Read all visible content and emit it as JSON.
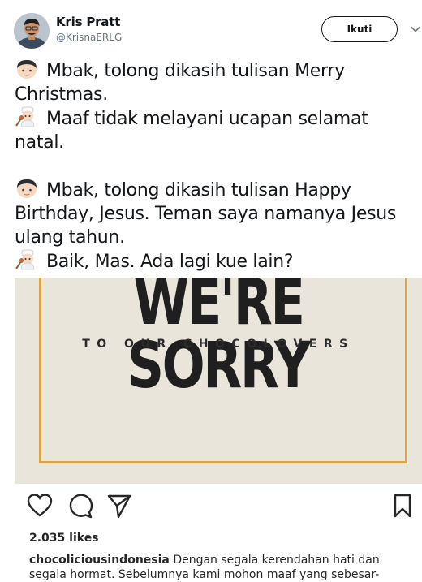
{
  "author": {
    "name": "Kris Pratt",
    "handle": "@KrisnaERLG",
    "avatar_icon": "avatar-photo"
  },
  "follow_button": {
    "label": "Ikuti"
  },
  "menu_icon": "chevron-down-icon",
  "tweet": {
    "lines": [
      {
        "emoji": "man-face",
        "text": "Mbak, tolong dikasih tulisan Merry"
      },
      {
        "emoji": "",
        "text": "Christmas."
      },
      {
        "emoji": "cook-woman",
        "text": "Maaf tidak melayani ucapan selamat"
      },
      {
        "emoji": "",
        "text": "natal."
      },
      {
        "emoji": "",
        "text": ""
      },
      {
        "emoji": "man-face",
        "text": "Mbak, tolong dikasih tulisan Happy"
      },
      {
        "emoji": "",
        "text": "Birthday, Jesus. Teman saya namanya Jesus"
      },
      {
        "emoji": "",
        "text": "ulang tahun."
      },
      {
        "emoji": "cook-woman",
        "text": "Baik, Mas. Ada lagi kue lain?"
      }
    ]
  },
  "media": {
    "headline": "WE'RE SORRY",
    "subline": "TO OUR CHOCOLOVERS",
    "background_color": "#e9e5da",
    "frame_color": "#d7a449"
  },
  "instagram": {
    "actions": [
      "heart-icon",
      "comment-icon",
      "share-icon",
      "bookmark-icon"
    ],
    "likes": "2.035 likes",
    "caption_user": "chocoliciousindonesia",
    "caption_line1": " Dengan segala kerendahan hati dan",
    "caption_line2": "segala hormat. Sebelumnya kami mohon maaf yang sebesar-"
  }
}
